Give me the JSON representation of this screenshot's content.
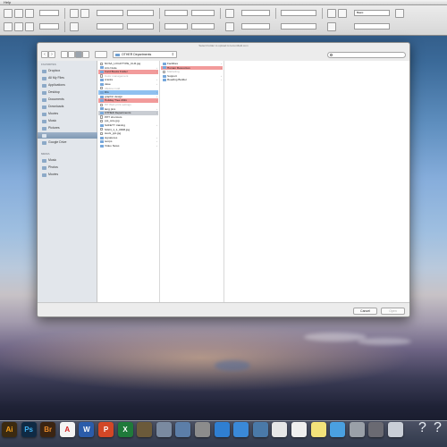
{
  "menubar": {
    "app_name": "Help"
  },
  "toolbar": {
    "zoom_value": "Basic"
  },
  "dialog": {
    "title": "Select Folder to upload to lemonfield.com",
    "path": "OTHER Departments"
  },
  "sidebar": {
    "sections": [
      {
        "heading": "FAVORITES",
        "items": [
          {
            "label": "Dropbox",
            "icon": "dropbox-icon"
          },
          {
            "label": "All My Files",
            "icon": "all-files-icon"
          },
          {
            "label": "Applications",
            "icon": "applications-icon"
          },
          {
            "label": "Desktop",
            "icon": "desktop-icon"
          },
          {
            "label": "Documents",
            "icon": "documents-icon"
          },
          {
            "label": "Downloads",
            "icon": "downloads-icon"
          },
          {
            "label": "Movies",
            "icon": "movies-icon"
          },
          {
            "label": "Music",
            "icon": "music-icon"
          },
          {
            "label": "Pictures",
            "icon": "pictures-icon"
          },
          {
            "label": "",
            "icon": "folder-icon",
            "selected": true
          },
          {
            "label": "Google Drive",
            "icon": "google-drive-icon"
          }
        ]
      },
      {
        "heading": "MEDIA",
        "items": [
          {
            "label": "Music",
            "icon": "music-icon"
          },
          {
            "label": "Photos",
            "icon": "photos-icon"
          },
          {
            "label": "Movies",
            "icon": "movies-icon"
          }
        ]
      }
    ]
  },
  "columns": [
    {
      "rows": [
        {
          "label": "NCSA_LOGOTYPE_CLR.jpg",
          "kind": "doc"
        },
        {
          "label": "Arts Node",
          "kind": "folder",
          "chev": true
        },
        {
          "label": "Card Books Folder",
          "kind": "folder",
          "style": "red",
          "chev": true
        },
        {
          "label": "Color management",
          "kind": "doc",
          "style": "grey"
        },
        {
          "label": "cranks",
          "kind": "folder",
          "chev": true
        },
        {
          "label": "dave",
          "kind": "folder",
          "chev": true
        },
        {
          "label": "dfsdcsc.indd",
          "kind": "doc",
          "style": "grey"
        },
        {
          "label": "DG",
          "kind": "folder",
          "style": "blue",
          "chev": true
        },
        {
          "label": "graphic design",
          "kind": "folder",
          "chev": true
        },
        {
          "label": "Holiday Tree 2011",
          "kind": "folder",
          "style": "red",
          "chev": true
        },
        {
          "label": "HP Web print settings",
          "kind": "doc",
          "style": "grey"
        },
        {
          "label": "lang pics",
          "kind": "folder",
          "chev": true
        },
        {
          "label": "OTHER Departments",
          "kind": "folder",
          "style": "sel",
          "chev": true
        },
        {
          "label": "PPT shortcuts",
          "kind": "doc"
        },
        {
          "label": "ppt_size.jpg",
          "kind": "doc"
        },
        {
          "label": "SAFETY training",
          "kind": "folder",
          "chev": true
        },
        {
          "label": "SIGN_1_1_0908.jpg",
          "kind": "doc"
        },
        {
          "label": "stock_ppt.jpg",
          "kind": "doc"
        },
        {
          "label": "signatures",
          "kind": "folder",
          "chev": true
        },
        {
          "label": "temps",
          "kind": "folder",
          "chev": true
        },
        {
          "label": "Video News",
          "kind": "folder",
          "chev": true
        }
      ]
    },
    {
      "rows": [
        {
          "label": "Facilities",
          "kind": "folder",
          "chev": true
        },
        {
          "label": "Human Resources",
          "kind": "folder",
          "style": "red",
          "chev": true
        },
        {
          "label": "Marketing",
          "kind": "doc",
          "style": "grey"
        },
        {
          "label": "Support",
          "kind": "folder",
          "chev": true
        },
        {
          "label": "Reading Builder",
          "kind": "folder",
          "chev": true
        }
      ]
    },
    {
      "rows": []
    }
  ],
  "footer": {
    "cancel_label": "Cancel",
    "open_label": "Open"
  },
  "dock": {
    "apps": [
      {
        "label": "Ai",
        "name": "illustrator-icon",
        "color": "#3b2a10",
        "fg": "#f7a21b"
      },
      {
        "label": "Ps",
        "name": "photoshop-icon",
        "color": "#0f2a44",
        "fg": "#3fb3f4"
      },
      {
        "label": "Br",
        "name": "bridge-icon",
        "color": "#3a2412",
        "fg": "#e88a2a"
      },
      {
        "label": "A",
        "name": "acrobat-icon",
        "color": "#f3f3f3",
        "fg": "#d32020"
      },
      {
        "label": "W",
        "name": "word-icon",
        "color": "#2b5caa",
        "fg": "#ffffff"
      },
      {
        "label": "P",
        "name": "powerpoint-icon",
        "color": "#d24726",
        "fg": "#ffffff"
      },
      {
        "label": "X",
        "name": "excel-icon",
        "color": "#1f7a3a",
        "fg": "#ffffff"
      },
      {
        "label": "",
        "name": "photos-icon",
        "color": "#6b5a3a",
        "fg": "#ffffff"
      },
      {
        "label": "",
        "name": "preview-icon",
        "color": "#7a8aa0",
        "fg": "#ffffff"
      },
      {
        "label": "",
        "name": "finder-icon",
        "color": "#5c7ea8",
        "fg": "#ffffff"
      },
      {
        "label": "",
        "name": "system-prefs-icon",
        "color": "#8c8c8c",
        "fg": "#ffffff"
      },
      {
        "label": "",
        "name": "itunes-icon",
        "color": "#2f7fd2",
        "fg": "#ffffff"
      },
      {
        "label": "",
        "name": "safari-icon",
        "color": "#3a89d8",
        "fg": "#ffffff"
      },
      {
        "label": "",
        "name": "mail-icon",
        "color": "#4a79a8",
        "fg": "#ffffff"
      },
      {
        "label": "",
        "name": "calendar-icon",
        "color": "#e6e6e6",
        "fg": "#cc2222"
      },
      {
        "label": "",
        "name": "textedit-icon",
        "color": "#efefef",
        "fg": "#333333"
      },
      {
        "label": "",
        "name": "stickies-icon",
        "color": "#f2e27a",
        "fg": "#333333"
      },
      {
        "label": "",
        "name": "app-store-icon",
        "color": "#4aa0e0",
        "fg": "#ffffff"
      },
      {
        "label": "",
        "name": "network-icon",
        "color": "#9aa0a8",
        "fg": "#ffffff"
      },
      {
        "label": "",
        "name": "time-machine-icon",
        "color": "#6a6a72",
        "fg": "#ffffff"
      },
      {
        "label": "",
        "name": "trash-icon",
        "color": "#c9ced6",
        "fg": "#333333"
      }
    ]
  }
}
